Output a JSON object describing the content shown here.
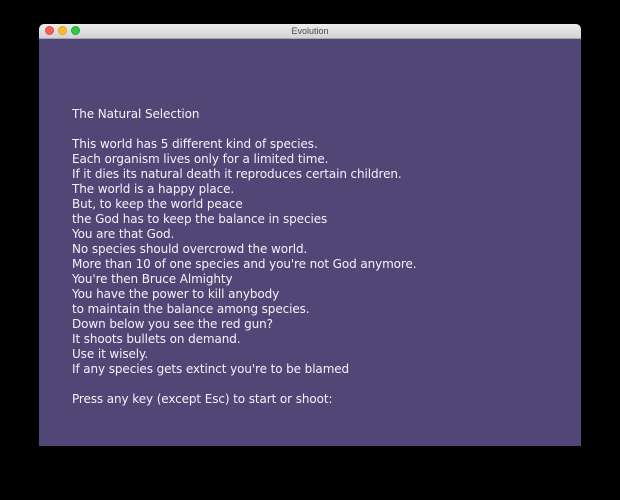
{
  "window": {
    "title": "Evolution"
  },
  "game": {
    "heading": "The Natural Selection",
    "intro_lines": [
      "This world has 5 different kind of species.",
      "Each organism lives only for a limited time.",
      "If it dies its natural death it reproduces certain children.",
      "The world is a happy place.",
      "But, to keep the world peace",
      "the God has to keep the balance in species",
      "You are that God.",
      "No species should overcrowd the world.",
      "More than 10 of one species and you're not God anymore.",
      "You're then Bruce Almighty",
      "You have the power to kill anybody",
      "to maintain the balance among species.",
      "Down below you see the red gun?",
      "It shoots bullets on demand.",
      "Use it wisely.",
      "If any species gets extinct you're to be blamed"
    ],
    "prompt": "Press any key (except Esc) to start or shoot:",
    "background_color": "#514777",
    "text_color": "#f4f2f8"
  }
}
